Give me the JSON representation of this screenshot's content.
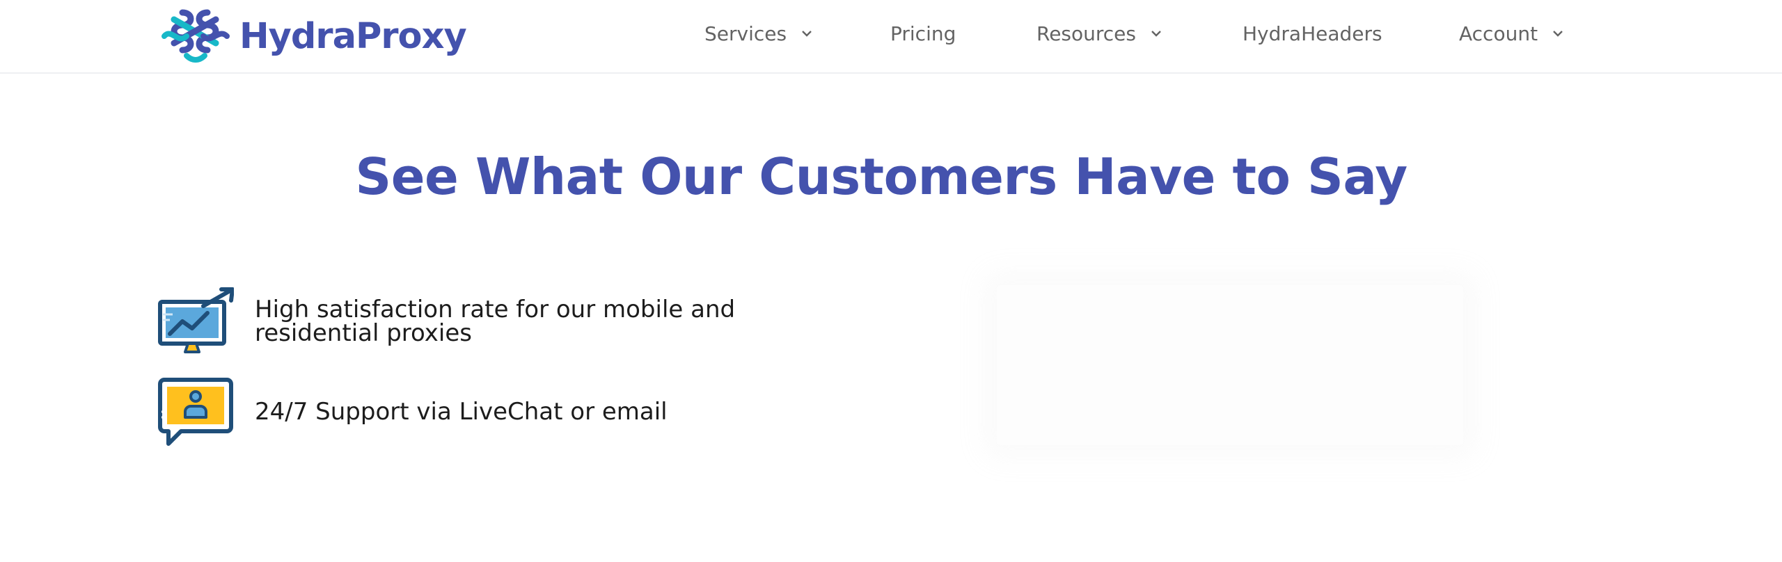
{
  "brand": {
    "name": "HydraProxy"
  },
  "nav": {
    "items": [
      {
        "label": "Services",
        "has_dropdown": true
      },
      {
        "label": "Pricing",
        "has_dropdown": false
      },
      {
        "label": "Resources",
        "has_dropdown": true
      },
      {
        "label": "HydraHeaders",
        "has_dropdown": false
      },
      {
        "label": "Account",
        "has_dropdown": true
      }
    ]
  },
  "section": {
    "heading": "See What Our Customers Have to Say"
  },
  "features": [
    {
      "icon": "growth-chart-monitor-icon",
      "text": "High satisfaction rate for our mobile and residential proxies"
    },
    {
      "icon": "support-chat-icon",
      "text": "24/7 Support via LiveChat or email"
    }
  ],
  "colors": {
    "brand": "#4452ad",
    "accent_teal": "#18b8c8",
    "nav_text": "#636363",
    "body_text": "#1c1c1c",
    "icon_dark": "#1f4e79",
    "icon_blue": "#5ba8dc",
    "icon_yellow": "#ffc01e"
  }
}
